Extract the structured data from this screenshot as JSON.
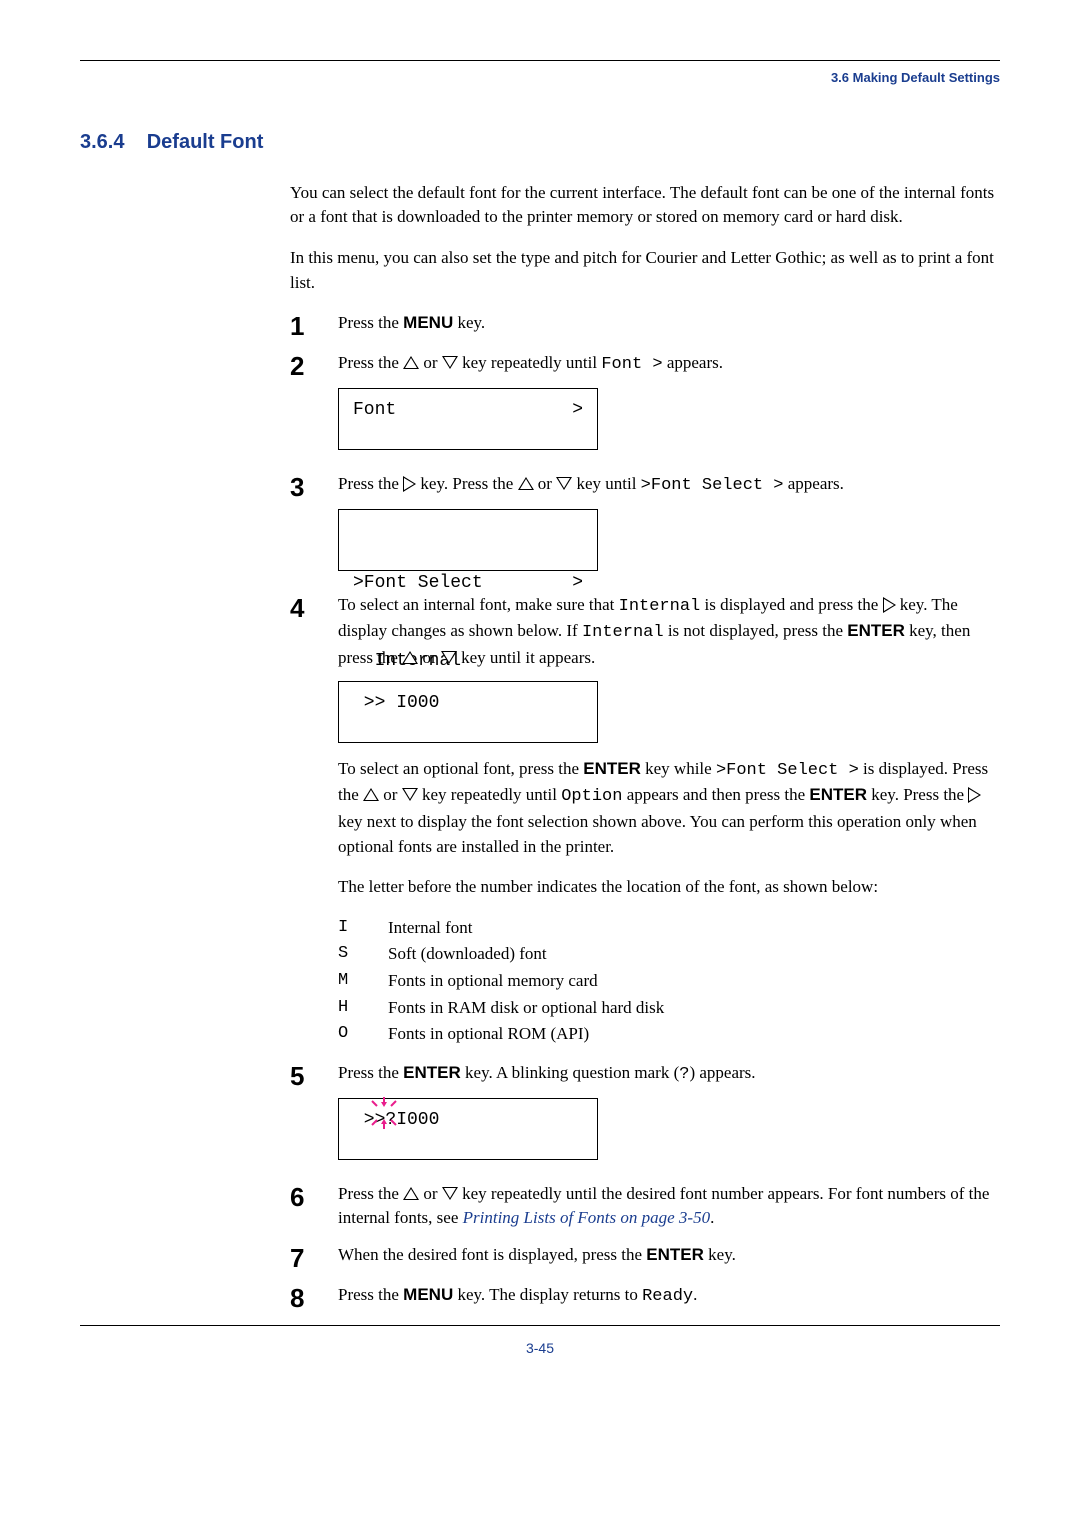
{
  "chapterHead": "3.6 Making Default Settings",
  "sectionNumber": "3.6.4",
  "sectionTitle": "Default Font",
  "intro1": "You can select the default font for the current interface. The default font can be one of the internal fonts or a font that is downloaded to the printer memory or stored on memory card or hard disk.",
  "intro2": "In this menu, you can also set the type and pitch for Courier and Letter Gothic; as well as to print a font list.",
  "keyMenu": "MENU",
  "keyEnter": "ENTER",
  "step1_a": "Press the ",
  "step1_b": " key.",
  "step2_a": "Press the ",
  "step2_b": " or ",
  "step2_c": " key repeatedly until ",
  "step2_mono": "Font  >",
  "step2_d": " appears.",
  "lcd1_left": "Font",
  "lcd1_right": ">",
  "step3_a": "Press the ",
  "step3_b": " key. Press the ",
  "step3_c": " or ",
  "step3_d": " key until ",
  "step3_mono": ">Font  Select  >",
  "step3_e": " appears.",
  "lcd2_l1_left": ">Font Select",
  "lcd2_l1_right": ">",
  "lcd2_l2": "  Internal",
  "step4_a": "To select an internal font, make sure that ",
  "step4_mono1": "Internal",
  "step4_b": " is displayed and press the ",
  "step4_c": " key. The display changes as shown below. If ",
  "step4_mono2": "Internal",
  "step4_d": " is not displayed, press the ",
  "step4_e": " key, then press the ",
  "step4_f": " or ",
  "step4_g": " key until it appears.",
  "lcd3": " >> I000",
  "optPara_a": "To select an optional font, press the ",
  "optPara_b": " key while ",
  "optPara_mono1": ">Font  Select  >",
  "optPara_c": " is displayed. Press the ",
  "optPara_d": " or ",
  "optPara_e": " key repeatedly until ",
  "optPara_mono2": "Option",
  "optPara_f": " appears and then press the ",
  "optPara_g": " key. Press the ",
  "optPara_h": " key next to display the font selection shown above. You can perform this operation only when optional fonts are installed in the printer.",
  "letterPara": "The letter before the number indicates the location of the font, as shown below:",
  "codes": {
    "I": {
      "c": "I",
      "l": "Internal font"
    },
    "S": {
      "c": "S",
      "l": "Soft (downloaded) font"
    },
    "M": {
      "c": "M",
      "l": "Fonts in optional memory card"
    },
    "H": {
      "c": "H",
      "l": "Fonts in RAM disk or optional hard disk"
    },
    "O": {
      "c": "O",
      "l": "Fonts in optional ROM (API)"
    }
  },
  "step5_a": "Press the ",
  "step5_b": " key. A blinking question mark (",
  "step5_mono": "?",
  "step5_c": ") appears.",
  "lcd4": " >>?I000",
  "step6_a": "Press the ",
  "step6_b": " or ",
  "step6_c": " key repeatedly until the desired font number appears. For font numbers of the internal fonts, see ",
  "step6_link": "Printing Lists of Fonts on page 3-50",
  "step6_d": ".",
  "step7_a": "When the desired font is displayed, press the ",
  "step7_b": " key.",
  "step8_a": "Press the ",
  "step8_b": " key. The display returns to ",
  "step8_mono": "Ready",
  "step8_c": ".",
  "pageNum": "3-45"
}
